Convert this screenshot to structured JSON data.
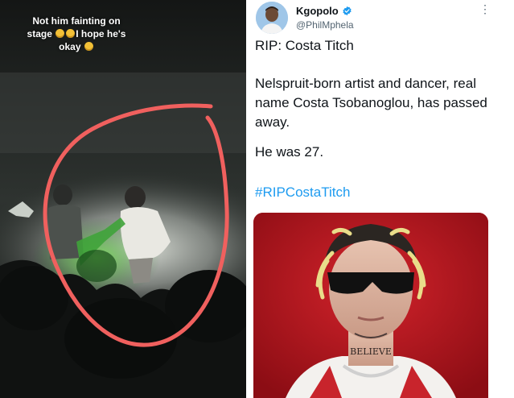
{
  "video": {
    "caption_line1": "Not him fainting on",
    "caption_line2a": "stage",
    "caption_line2b": "I hope he's",
    "caption_line3": "okay",
    "overlay_color": "#f0605e"
  },
  "tweet": {
    "display_name": "Kgopolo",
    "handle": "@PhilMphela",
    "title": "RIP: Costa Titch",
    "body": "Nelspruit-born artist and dancer, real name Costa Tsobanoglou, has passed away.",
    "age_line": "He was 27.",
    "hashtag": "#RIPCostaTitch",
    "photo_text": "BELIEVE",
    "colors": {
      "verified": "#1d9bf0",
      "hashtag": "#1d9bf0",
      "photo_bg": "#b5121b"
    }
  }
}
